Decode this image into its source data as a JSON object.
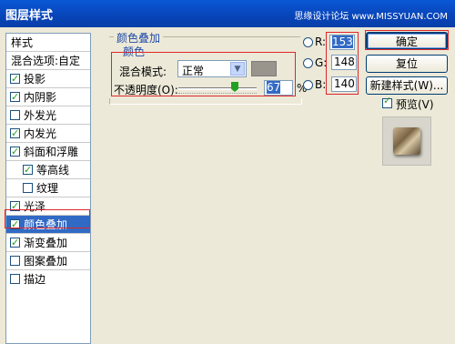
{
  "window": {
    "title": "图层样式",
    "watermark": "思缘设计论坛 www.MISSYUAN.COM"
  },
  "left_panel": {
    "header": "样式",
    "items": [
      {
        "label": "混合选项:自定",
        "checkbox": false
      },
      {
        "label": "投影",
        "checkbox": true,
        "checked": true
      },
      {
        "label": "内阴影",
        "checkbox": true,
        "checked": true
      },
      {
        "label": "外发光",
        "checkbox": true,
        "checked": false
      },
      {
        "label": "内发光",
        "checkbox": true,
        "checked": true
      },
      {
        "label": "斜面和浮雕",
        "checkbox": true,
        "checked": true
      },
      {
        "label": "等高线",
        "checkbox": true,
        "checked": true,
        "indent": true
      },
      {
        "label": "纹理",
        "checkbox": true,
        "checked": false,
        "indent": true
      },
      {
        "label": "光泽",
        "checkbox": true,
        "checked": true
      },
      {
        "label": "颜色叠加",
        "checkbox": true,
        "checked": true,
        "selected": true
      },
      {
        "label": "渐变叠加",
        "checkbox": true,
        "checked": true
      },
      {
        "label": "图案叠加",
        "checkbox": true,
        "checked": false
      },
      {
        "label": "描边",
        "checkbox": true,
        "checked": false
      }
    ]
  },
  "color_overlay": {
    "group_title": "颜色叠加",
    "sub_title": "颜色",
    "blend_mode_label": "混合模式:",
    "blend_mode_value": "正常",
    "swatch_color": "#99948c",
    "opacity_label": "不透明度(O):",
    "opacity_value": "67",
    "opacity_unit": "%"
  },
  "rgb": {
    "r_label": "R:",
    "r_value": "153",
    "g_label": "G:",
    "g_value": "148",
    "b_label": "B:",
    "b_value": "140"
  },
  "buttons": {
    "ok": "确定",
    "reset": "复位",
    "new_style": "新建样式(W)...",
    "preview_label": "预览(V)"
  },
  "colors": {
    "titlebar": "#0a58d6",
    "selection": "#316ac5",
    "highlight_border": "#e0262b"
  }
}
